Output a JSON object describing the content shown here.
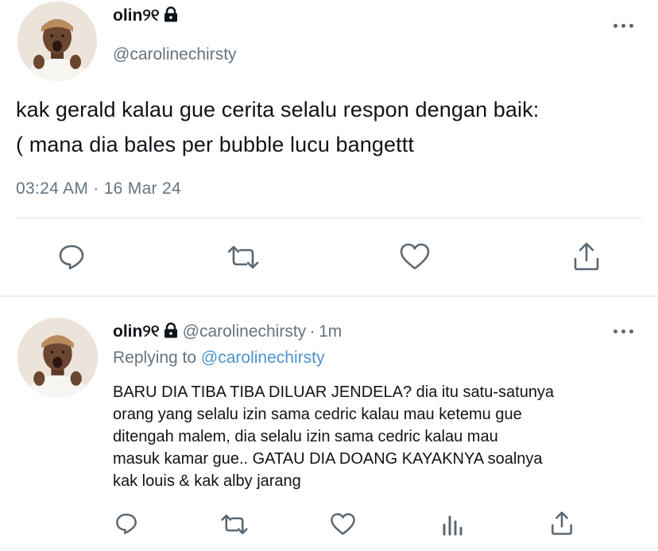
{
  "main_tweet": {
    "display_name": "olin୨୧",
    "handle": "@carolinechirsty",
    "text_line1": "kak gerald kalau gue cerita selalu respon dengan baik:",
    "text_line2": "( mana dia bales per bubble lucu bangettt",
    "timestamp": "03:24 AM · 16 Mar 24",
    "avatar_icon": "profile-photo",
    "protected_icon": "lock-icon"
  },
  "reply_tweet": {
    "display_name": "olin୨୧",
    "handle": "@carolinechirsty",
    "separator": "·",
    "time_ago": "1m",
    "replying_prefix": "Replying to",
    "replying_handle": "@carolinechirsty",
    "lines": [
      "BARU DIA TIBA TIBA DILUAR JENDELA? dia itu satu-satunya",
      "orang yang selalu izin sama cedric kalau mau ketemu gue",
      "ditengah malem, dia selalu izin sama cedric kalau mau",
      "masuk kamar gue.. GATAU DIA DOANG KAYAKNYA soalnya",
      "kak louis & kak alby jarang"
    ]
  },
  "actions": {
    "main": [
      "reply-icon",
      "retweet-icon",
      "like-icon",
      "share-icon"
    ],
    "reply": [
      "reply-icon",
      "retweet-icon",
      "like-icon",
      "analytics-icon",
      "share-icon"
    ]
  },
  "colors": {
    "text": "#0f1419",
    "secondary": "#66747f",
    "link": "#4c93cf",
    "divider": "#e3e6e8",
    "icon": "#5b6770"
  }
}
